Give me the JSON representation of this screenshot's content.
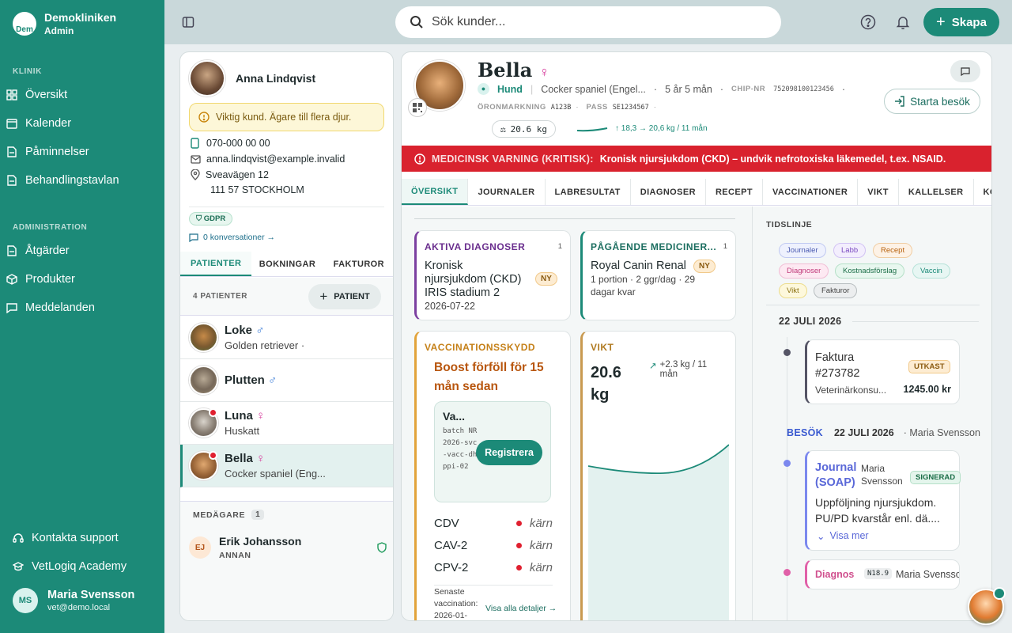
{
  "brand": {
    "name": "Demokliniken",
    "role": "Admin",
    "logo_text": "Dem"
  },
  "sidebar": {
    "section_klinik": "KLINIK",
    "klinik_items": [
      {
        "label": "Översikt",
        "icon": "grid-icon"
      },
      {
        "label": "Kalender",
        "icon": "calendar-icon"
      },
      {
        "label": "Påminnelser",
        "icon": "document-icon"
      },
      {
        "label": "Behandlingstavlan",
        "icon": "document-icon"
      }
    ],
    "section_admin": "ADMINISTRATION",
    "admin_items": [
      {
        "label": "Åtgärder",
        "icon": "document-icon"
      },
      {
        "label": "Produkter",
        "icon": "box-icon"
      },
      {
        "label": "Meddelanden",
        "icon": "chat-icon"
      }
    ],
    "support": "Kontakta support",
    "academy": "VetLogiq Academy",
    "user": {
      "initials": "MS",
      "name": "Maria Svensson",
      "email": "vet@demo.local"
    }
  },
  "topbar": {
    "search_placeholder": "Sök kunder...",
    "create_label": "Skapa"
  },
  "owner": {
    "name": "Anna Lindqvist",
    "warning": "Viktig kund. Ägare till flera djur.",
    "phone": "070-000 00 00",
    "email": "anna.lindqvist@example.invalid",
    "street": "Sveavägen 12",
    "city": "111 57 STOCKHOLM",
    "gdpr": "GDPR",
    "conversations": "0 konversationer →",
    "tabs": [
      "PATIENTER",
      "BOKNINGAR",
      "FAKTUROR"
    ],
    "patients_count": "4 PATIENTER",
    "add_patient": "PATIENT",
    "patients": [
      {
        "name": "Loke",
        "sex": "♂",
        "sub": "Golden retriever ·",
        "alert": false
      },
      {
        "name": "Plutten",
        "sex": "♂",
        "sub": "",
        "alert": false
      },
      {
        "name": "Luna",
        "sex": "♀",
        "sub": "Huskatt",
        "alert": true
      },
      {
        "name": "Bella",
        "sex": "♀",
        "sub": "Cocker spaniel (Eng...",
        "alert": true
      }
    ],
    "coowners_label": "MEDÄGARE",
    "coowners_count": "1",
    "coowner": {
      "initials": "EJ",
      "name": "Erik Johansson",
      "role": "ANNAN"
    }
  },
  "patient": {
    "name": "Bella",
    "sex": "♀",
    "species": "Hund",
    "breed": "Cocker spaniel (Engel...",
    "age": "5 år 5 mån",
    "chip_label": "CHIP-NR",
    "chip": "752098100123456",
    "ear_label": "ÖRONMARKNING",
    "ear": "A123B",
    "pass_label": "PASS",
    "pass": "SE1234567",
    "weight": "20.6 kg",
    "weight_trend": "↑ 18,3 → 20,6 kg / 11 mån",
    "start_visit": "Starta besök",
    "alert_label": "MEDICINSK VARNING (KRITISK):",
    "alert_text": "Kronisk njursjukdom (CKD) – undvik nefrotoxiska läkemedel, t.ex. NSAID.",
    "tabs": [
      "ÖVERSIKT",
      "JOURNALER",
      "LABRESULTAT",
      "DIAGNOSER",
      "RECEPT",
      "VACCINATIONER",
      "VIKT",
      "KALLELSER",
      "KOSTNADS"
    ]
  },
  "overview": {
    "diag": {
      "title": "AKTIVA DIAGNOSER",
      "count": "1",
      "text": "Kronisk njursjukdom (CKD) IRIS stadium 2",
      "date": "2026-07-22",
      "badge": "NY"
    },
    "meds": {
      "title": "PÅGÅENDE MEDICINER...",
      "count": "1",
      "name": "Royal Canin Renal",
      "badge": "NY",
      "detail": "1 portion · 2 ggr/dag · 29 dagar kvar"
    },
    "vacc": {
      "title": "VACCINATIONSSKYDD",
      "warning": "Boost förföll för 15 mån sedan",
      "item_name": "Va...",
      "batch": "batch NR2026-svc-vacc-dhppi-02",
      "register": "Registrera",
      "components": [
        {
          "name": "CDV",
          "type": "kärn"
        },
        {
          "name": "CAV-2",
          "type": "kärn"
        },
        {
          "name": "CPV-2",
          "type": "kärn"
        }
      ],
      "latest": "Senaste vaccination: 2026-01-",
      "details_link": "Visa alla detaljer →"
    },
    "weight": {
      "title": "VIKT",
      "value": "20.6 kg",
      "change": "+2.3 kg / 11 mån"
    }
  },
  "timeline": {
    "title": "TIDSLINJE",
    "filters": [
      "Journaler",
      "Labb",
      "Recept",
      "Diagnoser",
      "Kostnadsförslag",
      "Vaccin",
      "Vikt",
      "Fakturor"
    ],
    "date1": "22 JULI 2026",
    "invoice": {
      "title": "Faktura #273782",
      "badge": "UTKAST",
      "desc": "Veterinärkonsu...",
      "amount": "1245.00 kr"
    },
    "visit_label": "BESÖK",
    "visit_date": "22 JULI 2026",
    "visit_person": "· Maria Svensson",
    "journal": {
      "title": "Journal (SOAP)",
      "author": "Maria Svensson",
      "badge": "SIGNERAD",
      "text": "Uppföljning njursjukdom. PU/PD kvarstår enl. dä....",
      "more": "Visa mer"
    },
    "diagnos": {
      "title": "Diagnos",
      "code": "N18.9",
      "author": "Maria Svensson"
    }
  },
  "colors": {
    "primary": "#1c8a78",
    "alert": "#d9222e",
    "warning_orange": "#e2a33a",
    "diag_purple": "#7b3fa0"
  }
}
